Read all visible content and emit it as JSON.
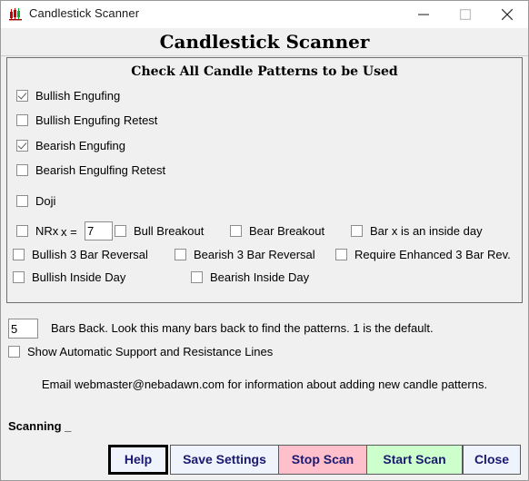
{
  "window": {
    "title": "Candlestick Scanner",
    "icon": "candlestick-chart-icon",
    "controls": {
      "minimize": "minimize-icon",
      "maximize": "maximize-icon",
      "close": "close-icon"
    }
  },
  "header": {
    "title": "Candlestick Scanner"
  },
  "group": {
    "title": "Check All Candle Patterns to be Used",
    "patterns": [
      {
        "label": "Bullish Engufing",
        "checked": true
      },
      {
        "label": "Bullish Engufing Retest",
        "checked": false
      },
      {
        "label": "Bearish Engufing",
        "checked": true
      },
      {
        "label": "Bearish Engulfing Retest",
        "checked": false
      },
      {
        "label": "Doji",
        "checked": false
      }
    ],
    "nrx": {
      "label": "NRx",
      "x_label": "x =",
      "checked": false,
      "value": "7"
    },
    "grid": [
      {
        "label": "Bull Breakout",
        "checked": false
      },
      {
        "label": "Bear Breakout",
        "checked": false
      },
      {
        "label": "Bar x is an inside day",
        "checked": false
      },
      {
        "label": "Bullish 3 Bar Reversal",
        "checked": false
      },
      {
        "label": "Bearish 3 Bar Reversal",
        "checked": false
      },
      {
        "label": "Require Enhanced 3 Bar Rev.",
        "checked": false
      },
      {
        "label": "Bullish Inside Day",
        "checked": false
      },
      {
        "label": "Bearish Inside Day",
        "checked": false
      }
    ]
  },
  "bars_back": {
    "value": "5",
    "description": "Bars Back.  Look this many bars back to find the patterns. 1 is the default."
  },
  "support_resistance": {
    "label": "Show Automatic Support and Resistance Lines",
    "checked": false
  },
  "info": "Email webmaster@nebadawn.com for information about adding new candle patterns.",
  "status": "Scanning _",
  "buttons": {
    "help": "Help",
    "save": "Save Settings",
    "stop": "Stop Scan",
    "start": "Start Scan",
    "close": "Close"
  },
  "colors": {
    "stop_scan_bg": "#ffc0cb",
    "start_scan_bg": "#ccffcc",
    "button_bg": "#eff3fb",
    "button_text": "#191970",
    "window_bg": "#f0f0f0"
  }
}
